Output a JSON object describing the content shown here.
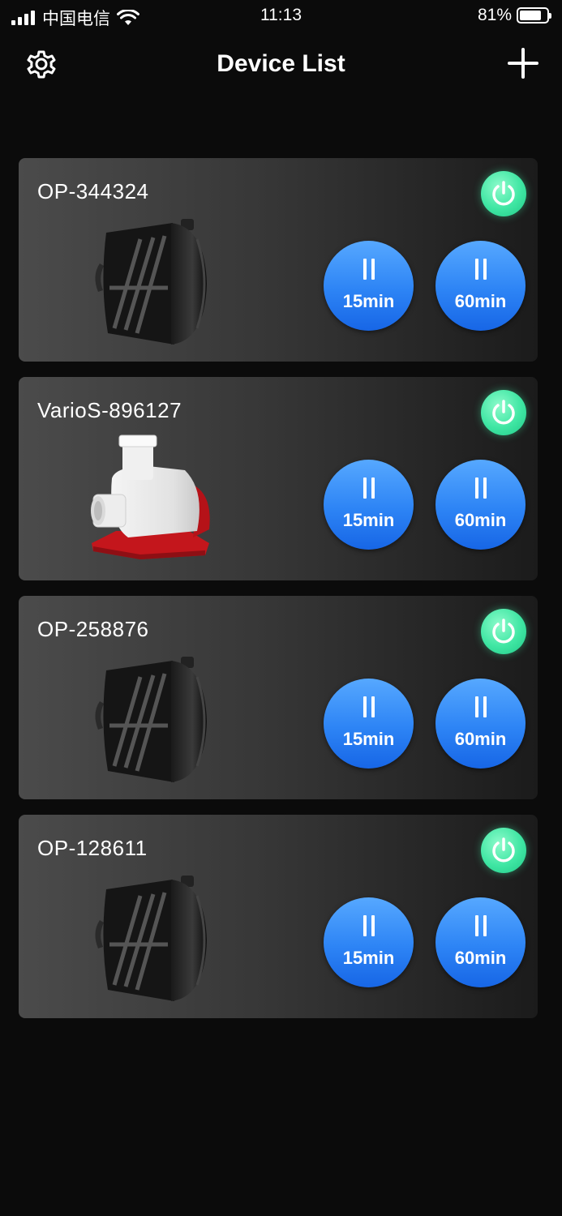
{
  "status_bar": {
    "carrier": "中国电信",
    "time": "11:13",
    "battery_percent": "81%",
    "battery_level": 0.81
  },
  "nav": {
    "title": "Device List",
    "left_icon": "gear-icon",
    "right_icon": "plus-icon"
  },
  "colors": {
    "background": "#0b0b0b",
    "power_on": "#3fe6a3",
    "timer_button": "#2d84f5"
  },
  "devices": [
    {
      "name": "OP-344324",
      "image": "wave-pump-black",
      "power": "on",
      "timer_15": "15min",
      "timer_60": "60min"
    },
    {
      "name": "VarioS-896127",
      "image": "return-pump-white-red",
      "power": "on",
      "timer_15": "15min",
      "timer_60": "60min"
    },
    {
      "name": "OP-258876",
      "image": "wave-pump-black",
      "power": "on",
      "timer_15": "15min",
      "timer_60": "60min"
    },
    {
      "name": "OP-128611",
      "image": "wave-pump-black",
      "power": "on",
      "timer_15": "15min",
      "timer_60": "60min"
    }
  ]
}
